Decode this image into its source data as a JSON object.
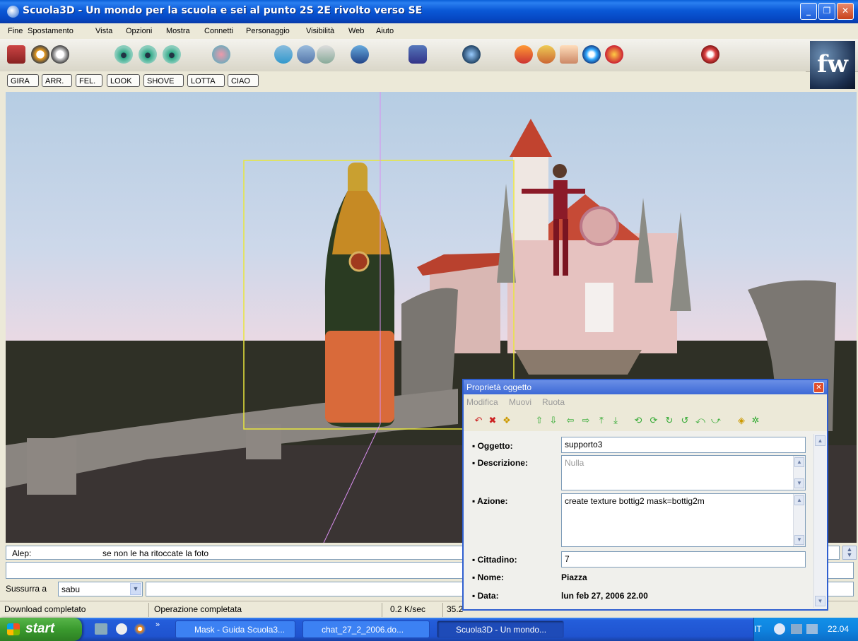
{
  "window": {
    "title": "Scuola3D - Un mondo per la scuola e sei al punto 2S 2E rivolto verso SE",
    "controls": [
      "minimize",
      "maximize",
      "close"
    ]
  },
  "menu": [
    "Fine",
    "Spostamento",
    "Vista",
    "Opzioni",
    "Mostra",
    "Connetti",
    "Personaggio",
    "Visibilità",
    "Web",
    "Aiuto"
  ],
  "gestures": [
    "GIRA",
    "ARR.",
    "FEL.",
    "LOOK",
    "SHOVE",
    "LOTTA",
    "CIAO"
  ],
  "logo_text": "fw",
  "chat": {
    "speaker": "Alep:",
    "message": "se non le ha ritoccate la foto"
  },
  "whisper": {
    "label": "Sussurra a",
    "target": "sabu"
  },
  "status": {
    "download": "Download completato",
    "operation": "Operazione completata",
    "speed": "0.2 K/sec",
    "extra": "35.2"
  },
  "dialog": {
    "title": "Proprietà oggetto",
    "menu": [
      "Modifica",
      "Muovi",
      "Ruota"
    ],
    "fields": {
      "oggetto_label": "Oggetto:",
      "oggetto_value": "supporto3",
      "descrizione_label": "Descrizione:",
      "descrizione_placeholder": "Nulla",
      "azione_label": "Azione:",
      "azione_value": "create texture bottig2 mask=bottig2m",
      "cittadino_label": "Cittadino:",
      "cittadino_value": "7",
      "nome_label": "Nome:",
      "nome_value": "Piazza",
      "data_label": "Data:",
      "data_value": "lun feb 27, 2006 22.00"
    }
  },
  "taskbar": {
    "start": "start",
    "tasks": [
      "Mask - Guida Scuola3...",
      "chat_27_2_2006.do...",
      "Scuola3D - Un mondo..."
    ],
    "language": "IT",
    "clock": "22.04"
  }
}
